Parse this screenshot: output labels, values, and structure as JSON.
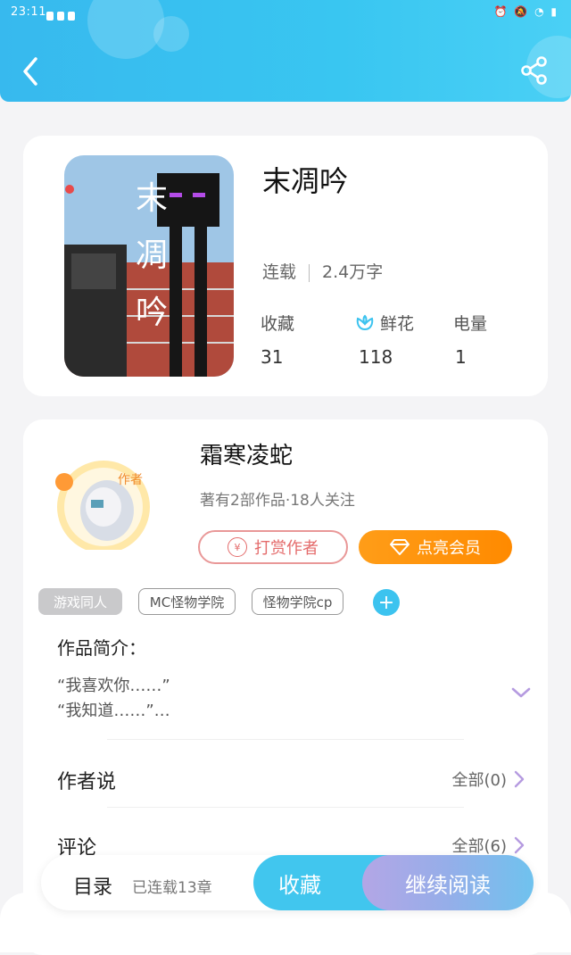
{
  "status_bar": {
    "time": "23:11",
    "right_icons": "⏰ 🔕 ◔ ▮"
  },
  "book": {
    "title": "末凋吟",
    "cover_title": "末凋吟",
    "status": "连载",
    "word_count": "2.4万字",
    "stats": [
      {
        "label": "收藏",
        "value": "31"
      },
      {
        "label": "鲜花",
        "value": "118",
        "icon": "flower-icon"
      },
      {
        "label": "电量",
        "value": "1"
      }
    ]
  },
  "author": {
    "name": "霜寒凌蛇",
    "avatar_badge": "作者",
    "meta": "著有2部作品·18人关注",
    "tip_label": "打赏作者",
    "vip_label": "点亮会员"
  },
  "tags": [
    "游戏同人",
    "MC怪物学院",
    "怪物学院cp"
  ],
  "intro": {
    "title": "作品简介：",
    "lines": [
      "“我喜欢你……”",
      "“我知道……”…"
    ]
  },
  "author_says": {
    "title": "作者说",
    "more": "全部(0)"
  },
  "comments": {
    "title": "评论",
    "more": "全部(6)"
  },
  "bottom_bar": {
    "toc_label": "目录",
    "chapters": "已连载13章",
    "favorite_label": "收藏",
    "read_label": "继续阅读"
  },
  "colors": {
    "header": "#37b9ee",
    "accent_blue": "#41c6ee",
    "vip_orange": "#ff8a00",
    "tip_red": "#e46b6b",
    "expand_purple": "#b59be0"
  }
}
